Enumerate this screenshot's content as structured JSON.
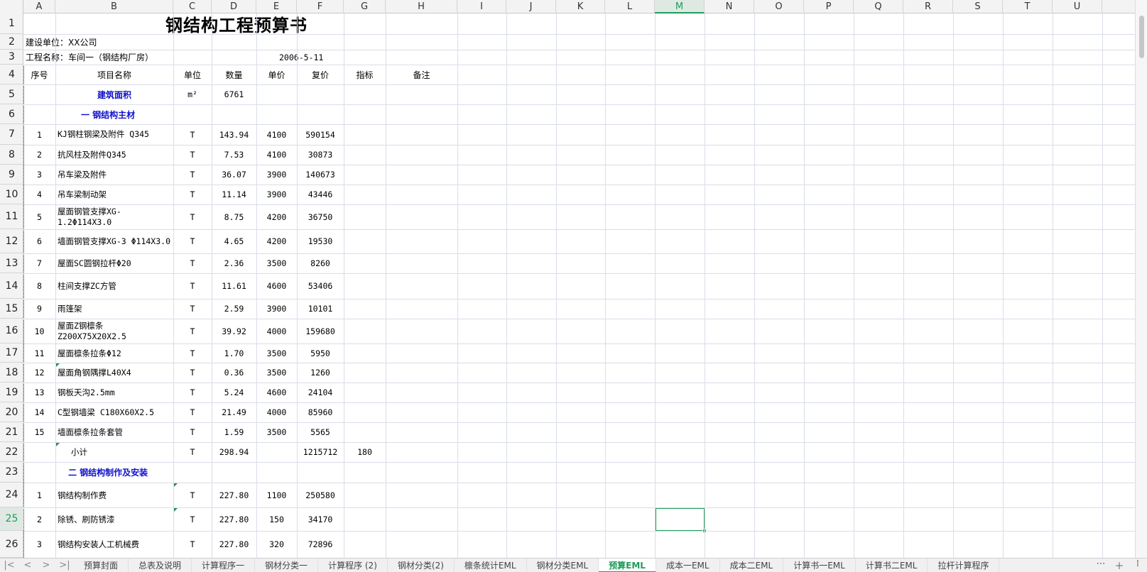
{
  "columns": [
    "A",
    "B",
    "C",
    "D",
    "E",
    "F",
    "G",
    "H",
    "I",
    "J",
    "K",
    "L",
    "M",
    "N",
    "O",
    "P",
    "Q",
    "R",
    "S",
    "T",
    "U"
  ],
  "active_column": "M",
  "rows": [
    "1",
    "2",
    "3",
    "4",
    "5",
    "6",
    "7",
    "8",
    "9",
    "10",
    "11",
    "12",
    "13",
    "14",
    "15",
    "16",
    "17",
    "18",
    "19",
    "20",
    "21",
    "22",
    "23",
    "24",
    "25",
    "26"
  ],
  "active_row": "25",
  "sheet": {
    "title": "钢结构工程预算书",
    "client": "建设单位：XX公司",
    "project": "工程名称：车间一（钢结构厂房）",
    "date": "2006-5-11",
    "headers": [
      "序号",
      "项目名称",
      "单位",
      "数量",
      "单价",
      "复价",
      "指标",
      "备注"
    ],
    "area": {
      "label": "建筑面积",
      "unit": "m²",
      "qty": "6761"
    },
    "section1": "一  钢结构主材",
    "items1": [
      {
        "no": "1",
        "name": "KJ钢柱钢梁及附件 Q345",
        "unit": "T",
        "qty": "143.94",
        "price": "4100",
        "total": "590154"
      },
      {
        "no": "2",
        "name": "抗风柱及附件Q345",
        "unit": "T",
        "qty": "7.53",
        "price": "4100",
        "total": "30873"
      },
      {
        "no": "3",
        "name": "吊车梁及附件",
        "unit": "T",
        "qty": "36.07",
        "price": "3900",
        "total": "140673"
      },
      {
        "no": "4",
        "name": "吊车梁制动架",
        "unit": "T",
        "qty": "11.14",
        "price": "3900",
        "total": "43446"
      },
      {
        "no": "5",
        "name": "屋面钢管支撑XG-1.2Φ114X3.0",
        "unit": "T",
        "qty": "8.75",
        "price": "4200",
        "total": "36750"
      },
      {
        "no": "6",
        "name": "墙面钢管支撑XG-3 Φ114X3.0",
        "unit": "T",
        "qty": "4.65",
        "price": "4200",
        "total": "19530"
      },
      {
        "no": "7",
        "name": "屋面SC圆钢拉杆Φ20",
        "unit": "T",
        "qty": "2.36",
        "price": "3500",
        "total": "8260"
      },
      {
        "no": "8",
        "name": "柱间支撑ZC方管",
        "unit": "T",
        "qty": "11.61",
        "price": "4600",
        "total": "53406"
      },
      {
        "no": "9",
        "name": "雨篷架",
        "unit": "T",
        "qty": "2.59",
        "price": "3900",
        "total": "10101"
      },
      {
        "no": "10",
        "name": "屋面Z钢檩条Z200X75X20X2.5",
        "unit": "T",
        "qty": "39.92",
        "price": "4000",
        "total": "159680"
      },
      {
        "no": "11",
        "name": "屋面檩条拉条Φ12",
        "unit": "T",
        "qty": "1.70",
        "price": "3500",
        "total": "5950"
      },
      {
        "no": "12",
        "name": "屋面角钢隅撑L40X4",
        "unit": "T",
        "qty": "0.36",
        "price": "3500",
        "total": "1260"
      },
      {
        "no": "13",
        "name": "钢板天沟2.5mm",
        "unit": "T",
        "qty": "5.24",
        "price": "4600",
        "total": "24104"
      },
      {
        "no": "14",
        "name": "C型钢墙梁  C180X60X2.5",
        "unit": "T",
        "qty": "21.49",
        "price": "4000",
        "total": "85960"
      },
      {
        "no": "15",
        "name": "墙面檩条拉条套管",
        "unit": "T",
        "qty": "1.59",
        "price": "3500",
        "total": "5565"
      }
    ],
    "subtotal": {
      "label": "小计",
      "unit": "T",
      "qty": "298.94",
      "total": "1215712",
      "index": "180"
    },
    "section2": "二  钢结构制作及安装",
    "items2": [
      {
        "no": "1",
        "name": "钢结构制作费",
        "unit": "T",
        "qty": "227.80",
        "price": "1100",
        "total": "250580"
      },
      {
        "no": "2",
        "name": "除锈、刷防锈漆",
        "unit": "T",
        "qty": "227.80",
        "price": "150",
        "total": "34170"
      },
      {
        "no": "3",
        "name": "钢结构安装人工机械费",
        "unit": "T",
        "qty": "227.80",
        "price": "320",
        "total": "72896"
      }
    ]
  },
  "tabs": [
    "预算封面",
    "总表及说明",
    "计算程序一",
    "钢材分类一",
    "计算程序 (2)",
    "钢材分类(2)",
    "檩条统计EML",
    "钢材分类EML",
    "预算EML",
    "成本一EML",
    "成本二EML",
    "计算书一EML",
    "计算书二EML",
    "拉杆计算程序"
  ],
  "active_tab": "预算EML",
  "nav_icons": [
    "first-sheet-icon",
    "prev-sheet-icon",
    "next-sheet-icon",
    "last-sheet-icon"
  ],
  "colors": {
    "accent": "#1e9e5a",
    "section_text": "#1111cc"
  }
}
